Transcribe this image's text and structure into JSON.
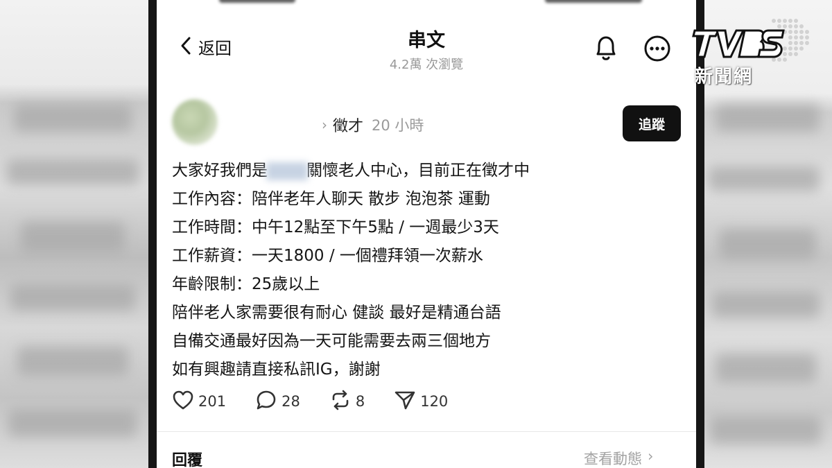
{
  "header": {
    "back_label": "返回",
    "title": "串文",
    "views": "4.2萬 次瀏覽"
  },
  "post": {
    "author": "徵才",
    "time": "20 小時",
    "follow_label": "追蹤",
    "lines": [
      {
        "before": "大家好我們是",
        "after": "關懷老人中心，目前正在徵才中"
      },
      "工作內容：陪伴老年人聊天 散步 泡泡茶 運動",
      "工作時間：中午12點至下午5點 / 一週最少3天",
      "工作薪資：一天1800 / 一個禮拜領一次薪水",
      "年齡限制：25歲以上",
      "陪伴老人家需要很有耐心 健談 最好是精通台語",
      "自備交通最好因為一天可能需要去兩三個地方",
      "如有興趣請直接私訊IG，謝謝"
    ],
    "stats": {
      "likes": "201",
      "comments": "28",
      "reposts": "8",
      "shares": "120"
    }
  },
  "footer": {
    "replies_label": "回覆",
    "activity_label": "查看動態",
    "activity_chevron": "›"
  },
  "watermark": {
    "text": "新聞網"
  },
  "icons": {
    "back": "chevron-left-icon",
    "bell": "bell-icon",
    "more": "more-icon",
    "like": "heart-icon",
    "comment": "comment-icon",
    "repost": "repost-icon",
    "share": "send-icon"
  },
  "colors": {
    "follow_button": "#111111",
    "muted_text": "#9a9a9a",
    "frame": "#161616"
  }
}
